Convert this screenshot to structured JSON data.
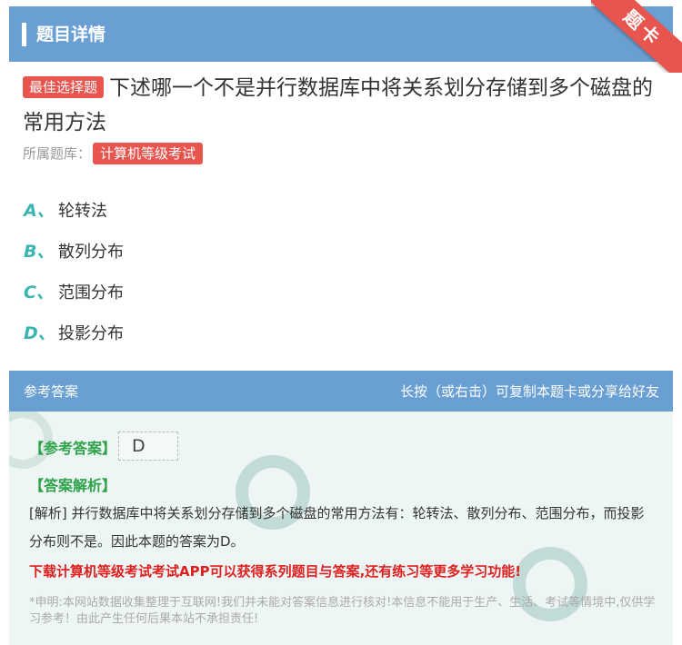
{
  "header": {
    "title": "题目详情",
    "ribbon": "题卡"
  },
  "question": {
    "badge": "最佳选择题",
    "text": "下述哪一个不是并行数据库中将关系划分存储到多个磁盘的常用方法",
    "bank_label": "所属题库：",
    "bank": "计算机等级考试"
  },
  "options": [
    {
      "letter": "A、",
      "text": "轮转法"
    },
    {
      "letter": "B、",
      "text": "散列分布"
    },
    {
      "letter": "C、",
      "text": "范围分布"
    },
    {
      "letter": "D、",
      "text": "投影分布"
    }
  ],
  "answer_panel": {
    "title": "参考答案",
    "hint": "长按（或右击）可复制本题卡或分享给好友",
    "answer_label": "【参考答案】",
    "answer_value": "D",
    "analysis_label": "【答案解析】",
    "analysis_text": "[解析] 并行数据库中将关系划分存储到多个磁盘的常用方法有：轮转法、散列分布、范围分布，而投影分布则不是。因此本题的答案为D。",
    "promo": "下载计算机等级考试考试APP可以获得系列题目与答案,还有练习等更多学习功能!",
    "disclaimer": "*申明:本网站数据收集整理于互联网!我们并未能对答案信息进行核对!本信息不能用于生产、生活、考试等情境中,仅供学习参考！由此产生任何后果本站不承担责任!"
  },
  "colors": {
    "header_bg": "#6a9fd3",
    "accent_red": "#e8544e",
    "option_letter": "#3ab5b0",
    "answer_label": "#2fa34a",
    "promo": "#e01f1f",
    "panel_bg": "#eef6f5"
  }
}
